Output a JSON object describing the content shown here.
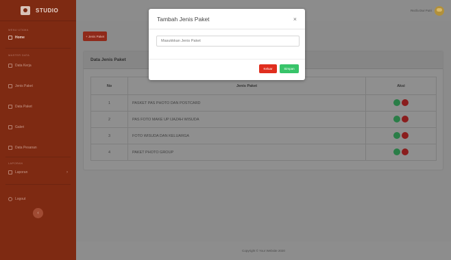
{
  "brand": {
    "name": "STUDIO",
    "icon": "camera-icon"
  },
  "sidebar": {
    "section_main": "MENU UTAMA",
    "home": "Home",
    "section_master": "MASTER DATA",
    "items": [
      {
        "label": "Data Kerja",
        "icon": "table-icon"
      },
      {
        "label": "Jenis Paket",
        "icon": "table-icon"
      },
      {
        "label": "Data Paket",
        "icon": "table-icon"
      },
      {
        "label": "Galeri",
        "icon": "image-icon"
      },
      {
        "label": "Data Pesanan",
        "icon": "table-icon"
      }
    ],
    "section_report": "LAPORAN",
    "laporan": "Laporan",
    "logout": "Logout",
    "toggle_icon": "chevron-left-icon"
  },
  "topbar": {
    "user_name": "Rezfa Dwi Putri"
  },
  "content": {
    "add_button": "+ Jenis Paket",
    "card_title": "Data Jenis Paket",
    "table": {
      "headers": [
        "No",
        "Jenis Paket",
        "Aksi"
      ],
      "rows": [
        {
          "no": "1",
          "jenis": "PASKET PAS PHOTO DAN POSTCARD"
        },
        {
          "no": "2",
          "jenis": "PAS FOTO MAKE UP IJAZAH WISUDA"
        },
        {
          "no": "3",
          "jenis": "FOTO WISUDA DAN KELUARGA"
        },
        {
          "no": "4",
          "jenis": "PAKET PHOTO GROUP"
        }
      ]
    }
  },
  "footer": {
    "text": "Copyright © Your Website 2020"
  },
  "modal": {
    "title": "Tambah Jenis Paket",
    "close": "×",
    "input_placeholder": "Masukkkan Jenis Paket",
    "btn_keluar": "Keluar",
    "btn_simpan": "Simpan"
  },
  "colors": {
    "sidebar": "#7e2a12",
    "danger": "#e02e1e",
    "success": "#38c46a"
  }
}
